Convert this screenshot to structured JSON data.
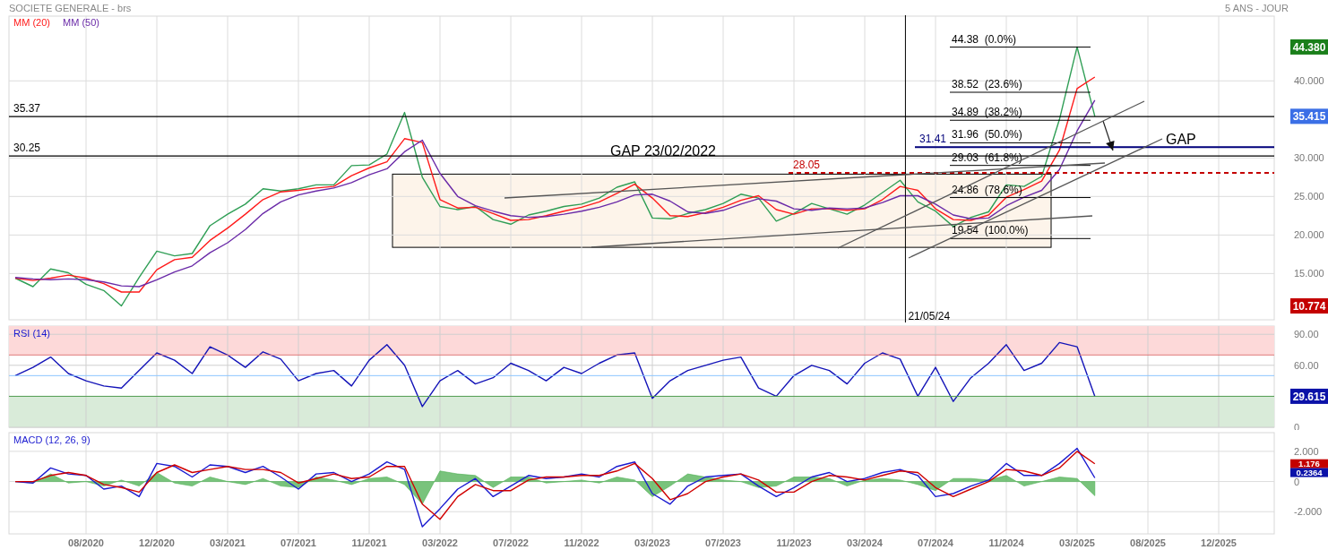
{
  "header": {
    "title": "SOCIETE GENERALE - brs",
    "period": "5 ANS - JOUR"
  },
  "price_chart": {
    "chart_data": {
      "type": "line",
      "ylim": [
        9.0,
        48.4
      ],
      "yticks": [
        {
          "value": 40,
          "label": "40.000"
        },
        {
          "value": 30,
          "label": "30.000"
        },
        {
          "value": 25,
          "label": "25.000"
        },
        {
          "value": 20,
          "label": "20.000"
        },
        {
          "value": 15,
          "label": "15.000"
        }
      ],
      "categories": [
        null,
        null,
        null,
        null,
        null,
        null,
        null,
        null,
        null,
        null,
        null,
        null,
        null,
        null,
        null,
        null,
        null,
        null,
        null,
        null,
        null,
        null,
        null,
        null,
        null,
        null,
        null,
        null,
        null,
        null,
        null,
        null,
        null,
        null,
        null,
        null,
        null,
        null,
        null,
        null,
        null,
        null,
        null,
        null,
        null,
        null,
        null,
        null,
        null,
        null,
        null,
        null,
        null,
        null,
        null,
        null,
        null,
        null,
        null,
        null,
        null,
        null,
        null,
        null,
        null,
        null,
        null,
        null,
        null,
        null,
        null,
        null
      ],
      "series": [
        {
          "color": "#2f9e55",
          "values": [
            14.4,
            13.3,
            15.6,
            15.1,
            13.6,
            12.8,
            10.8,
            14.5,
            17.9,
            17.3,
            17.6,
            21.2,
            22.7,
            24,
            26,
            25.7,
            26,
            26.5,
            26.5,
            29,
            29.1,
            30.5,
            35.9,
            27.5,
            23.7,
            23.3,
            23.7,
            22,
            21.4,
            22.6,
            23.1,
            23.7,
            24,
            24.8,
            26.2,
            26.9,
            22.2,
            22.1,
            22.8,
            23.3,
            24.1,
            25.3,
            24.8,
            21.8,
            22.8,
            24.1,
            23.4,
            22.7,
            23.9,
            25.5,
            27.1,
            24.3,
            23.1,
            21.1,
            22.3,
            23,
            26.5,
            26.3,
            27.6,
            35,
            44.4,
            35.4,
            null,
            null,
            null,
            null,
            null,
            null,
            null,
            null,
            null,
            null
          ]
        },
        {
          "name": "MM (20)",
          "color": "#ff1a1a",
          "values": [
            14.4,
            14.1,
            14.4,
            14.8,
            14.4,
            13.7,
            12.6,
            12.6,
            15.5,
            16.8,
            17.1,
            19.3,
            20.9,
            22.7,
            24.6,
            25.6,
            25.8,
            26.1,
            26.3,
            27.7,
            28.7,
            29.5,
            32.5,
            32,
            24.6,
            23.5,
            23.6,
            22.8,
            21.9,
            22,
            22.5,
            23.1,
            23.6,
            24.3,
            25.4,
            26.6,
            24.8,
            22.5,
            22.4,
            22.9,
            23.6,
            24.5,
            25.1,
            23.3,
            22.7,
            23.4,
            23.4,
            23.2,
            23.4,
            24.6,
            26.3,
            25.8,
            23.4,
            22,
            21.9,
            22.6,
            24.9,
            25.9,
            27,
            31,
            39,
            40.5,
            null,
            null,
            null,
            null,
            null,
            null,
            null,
            null,
            null,
            null
          ]
        },
        {
          "name": "MM (50)",
          "color": "#6a2aa8",
          "values": [
            14.5,
            14.3,
            14.2,
            14.3,
            14.2,
            13.9,
            13.4,
            13.3,
            14.2,
            15.2,
            16,
            17.7,
            19,
            20.7,
            22.8,
            24.3,
            25.2,
            25.7,
            26.1,
            26.8,
            27.8,
            28.6,
            30.8,
            32.3,
            28,
            25,
            23.8,
            23.1,
            22.5,
            22.3,
            22.4,
            22.7,
            23.1,
            23.6,
            24.3,
            25.2,
            25.3,
            24.4,
            23,
            22.8,
            23.2,
            24,
            24.7,
            24.4,
            23.4,
            23.2,
            23.5,
            23.4,
            23.5,
            24.2,
            25.1,
            25.1,
            24,
            22.6,
            22.1,
            22.2,
            23.8,
            24.9,
            25.8,
            28.5,
            33.5,
            37.5,
            null,
            null,
            null,
            null,
            null,
            null,
            null,
            null,
            null,
            null
          ]
        }
      ],
      "grid": true,
      "ref_lines": [
        {
          "axis": "y",
          "value": 35.37,
          "label": "35.37"
        },
        {
          "axis": "y",
          "value": 30.25,
          "label": "30.25"
        },
        {
          "axis": "y",
          "value": 28.05,
          "label": "28.05"
        },
        {
          "axis": "y",
          "value": 31.41,
          "label": "31.41"
        },
        {
          "axis": "y",
          "value": 44.38,
          "label": "44.38  (0.0%)"
        },
        {
          "axis": "y",
          "value": 38.52,
          "label": "38.52  (23.6%)"
        },
        {
          "axis": "y",
          "value": 34.89,
          "label": "34.89  (38.2%)"
        },
        {
          "axis": "y",
          "value": 31.96,
          "label": "31.96  (50.0%)"
        },
        {
          "axis": "y",
          "value": 29.03,
          "label": "29.03  (61.8%)"
        },
        {
          "axis": "y",
          "value": 24.86,
          "label": "24.86  (78.6%)"
        },
        {
          "axis": "y",
          "value": 19.54,
          "label": "19.54  (100.0%)"
        }
      ],
      "annotations": [
        "GAP 23/02/2022",
        "GAP",
        "44.380",
        "35.415",
        "10.774",
        "21/05/24"
      ]
    }
  },
  "rsi_panel": {
    "chart_data": {
      "type": "line",
      "title": "RSI (14)",
      "ylim": [
        0,
        98
      ],
      "yticks": [
        {
          "value": 90,
          "label": "90.00"
        },
        {
          "value": 60,
          "label": "60.00"
        },
        {
          "value": 0,
          "label": "0"
        }
      ],
      "categories": [
        null,
        null,
        null,
        null,
        null,
        null,
        null,
        null,
        null,
        null,
        null,
        null,
        null,
        null,
        null,
        null,
        null,
        null,
        null,
        null,
        null,
        null,
        null,
        null,
        null,
        null,
        null,
        null,
        null,
        null,
        null,
        null,
        null,
        null,
        null,
        null,
        null,
        null,
        null,
        null,
        null,
        null,
        null,
        null,
        null,
        null,
        null,
        null,
        null,
        null,
        null,
        null,
        null,
        null,
        null,
        null,
        null,
        null,
        null,
        null,
        null,
        null,
        null,
        null,
        null,
        null,
        null,
        null,
        null,
        null,
        null,
        null
      ],
      "series": [
        {
          "color": "#1414b8",
          "values": [
            50,
            58,
            68,
            52,
            45,
            40,
            38,
            55,
            72,
            65,
            52,
            78,
            70,
            58,
            73,
            66,
            45,
            52,
            55,
            40,
            65,
            80,
            60,
            20,
            45,
            55,
            42,
            48,
            62,
            55,
            45,
            58,
            52,
            62,
            70,
            72,
            28,
            45,
            55,
            60,
            65,
            68,
            38,
            30,
            50,
            60,
            55,
            42,
            62,
            72,
            66,
            30,
            58,
            25,
            48,
            62,
            80,
            55,
            62,
            82,
            78,
            30,
            null,
            null,
            null,
            null,
            null,
            null,
            null,
            null,
            null,
            null
          ]
        }
      ],
      "grid": true,
      "ref_lines": [
        {
          "axis": "y",
          "value": 70
        },
        {
          "axis": "y",
          "value": 50
        },
        {
          "axis": "y",
          "value": 30
        }
      ],
      "annotations": [
        "29.615"
      ]
    }
  },
  "macd_panel": {
    "chart_data": {
      "type": "line",
      "title": "MACD (12, 26, 9)",
      "ylim": [
        -3.47,
        3.24
      ],
      "yticks": [
        {
          "value": 2,
          "label": "2.000"
        },
        {
          "value": 0,
          "label": "0"
        },
        {
          "value": -2,
          "label": "-2.000"
        }
      ],
      "categories": [
        null,
        null,
        null,
        null,
        "08/2020",
        null,
        null,
        null,
        "12/2020",
        null,
        null,
        null,
        "03/2021",
        null,
        null,
        null,
        "07/2021",
        null,
        null,
        null,
        "11/2021",
        null,
        null,
        null,
        "03/2022",
        null,
        null,
        null,
        "07/2022",
        null,
        null,
        null,
        "11/2022",
        null,
        null,
        null,
        "03/2023",
        null,
        null,
        null,
        "07/2023",
        null,
        null,
        null,
        "11/2023",
        null,
        null,
        null,
        "03/2024",
        null,
        null,
        null,
        "07/2024",
        null,
        null,
        null,
        "11/2024",
        null,
        null,
        null,
        "03/2025",
        null,
        null,
        null,
        "08/2025",
        null,
        null,
        null,
        "12/2025",
        null,
        null,
        null
      ],
      "series": [
        {
          "type": "area",
          "color": "#4caf50",
          "values": [
            0,
            -0.1,
            0.5,
            -0.1,
            0,
            -0.3,
            0.1,
            -0.3,
            0.6,
            -0.1,
            -0.3,
            0.3,
            0,
            -0.2,
            0.2,
            -0.3,
            -0.4,
            0.3,
            0.1,
            -0.2,
            0.2,
            0.3,
            -0.2,
            -1.5,
            0.7,
            0.5,
            0.4,
            -0.4,
            0.3,
            0.3,
            -0.1,
            0,
            0.1,
            -0.1,
            0.3,
            0.1,
            -1.0,
            -0.3,
            0.5,
            0.3,
            0.1,
            0,
            -0.4,
            -0.3,
            0.3,
            0.3,
            0.2,
            -0.3,
            0.1,
            0.2,
            0.1,
            -0.2,
            -0.6,
            0.2,
            0.2,
            0.1,
            0.4,
            -0.3,
            0,
            0.3,
            0.2,
            -0.94,
            null,
            null,
            null,
            null,
            null,
            null,
            null,
            null,
            null,
            null
          ]
        },
        {
          "type": "line",
          "color": "#1a1ad0",
          "values": [
            0,
            -0.1,
            0.9,
            0.5,
            0.4,
            -0.5,
            -0.3,
            -1.0,
            1.2,
            1.0,
            0.3,
            1.1,
            1.0,
            0.6,
            1.0,
            0.3,
            -0.5,
            0.5,
            0.6,
            0.0,
            0.5,
            1.3,
            0.8,
            -3.0,
            -1.8,
            -0.5,
            0.2,
            -1.0,
            -0.3,
            0.4,
            0.2,
            0.3,
            0.5,
            0.3,
            1.0,
            1.3,
            -0.8,
            -1.5,
            -0.3,
            0.3,
            0.4,
            0.5,
            -0.3,
            -1.0,
            -0.4,
            0.3,
            0.6,
            0.0,
            0.2,
            0.6,
            0.8,
            0.4,
            -1.0,
            -0.8,
            -0.3,
            0.1,
            1.2,
            0.4,
            0.4,
            1.2,
            2.2,
            0.24,
            null,
            null,
            null,
            null,
            null,
            null,
            null,
            null,
            null,
            null
          ]
        },
        {
          "type": "line",
          "color": "#d00000",
          "values": [
            0,
            0,
            0.4,
            0.6,
            0.4,
            -0.2,
            -0.4,
            -0.7,
            0.6,
            1.1,
            0.6,
            0.8,
            1.0,
            0.8,
            0.8,
            0.6,
            -0.1,
            0.2,
            0.5,
            0.2,
            0.3,
            1.0,
            1.0,
            -1.5,
            -2.5,
            -1.0,
            -0.2,
            -0.6,
            -0.6,
            0.1,
            0.3,
            0.3,
            0.4,
            0.4,
            0.7,
            1.2,
            0.2,
            -1.2,
            -0.8,
            0.0,
            0.3,
            0.5,
            0.1,
            -0.7,
            -0.7,
            0.0,
            0.4,
            0.3,
            0.1,
            0.4,
            0.7,
            0.6,
            -0.4,
            -1.0,
            -0.5,
            0.0,
            0.8,
            0.7,
            0.4,
            0.9,
            2.0,
            1.18,
            null,
            null,
            null,
            null,
            null,
            null,
            null,
            null,
            null,
            null
          ]
        }
      ],
      "grid": true,
      "annotations": [
        "1.176",
        "0.2364"
      ]
    }
  }
}
